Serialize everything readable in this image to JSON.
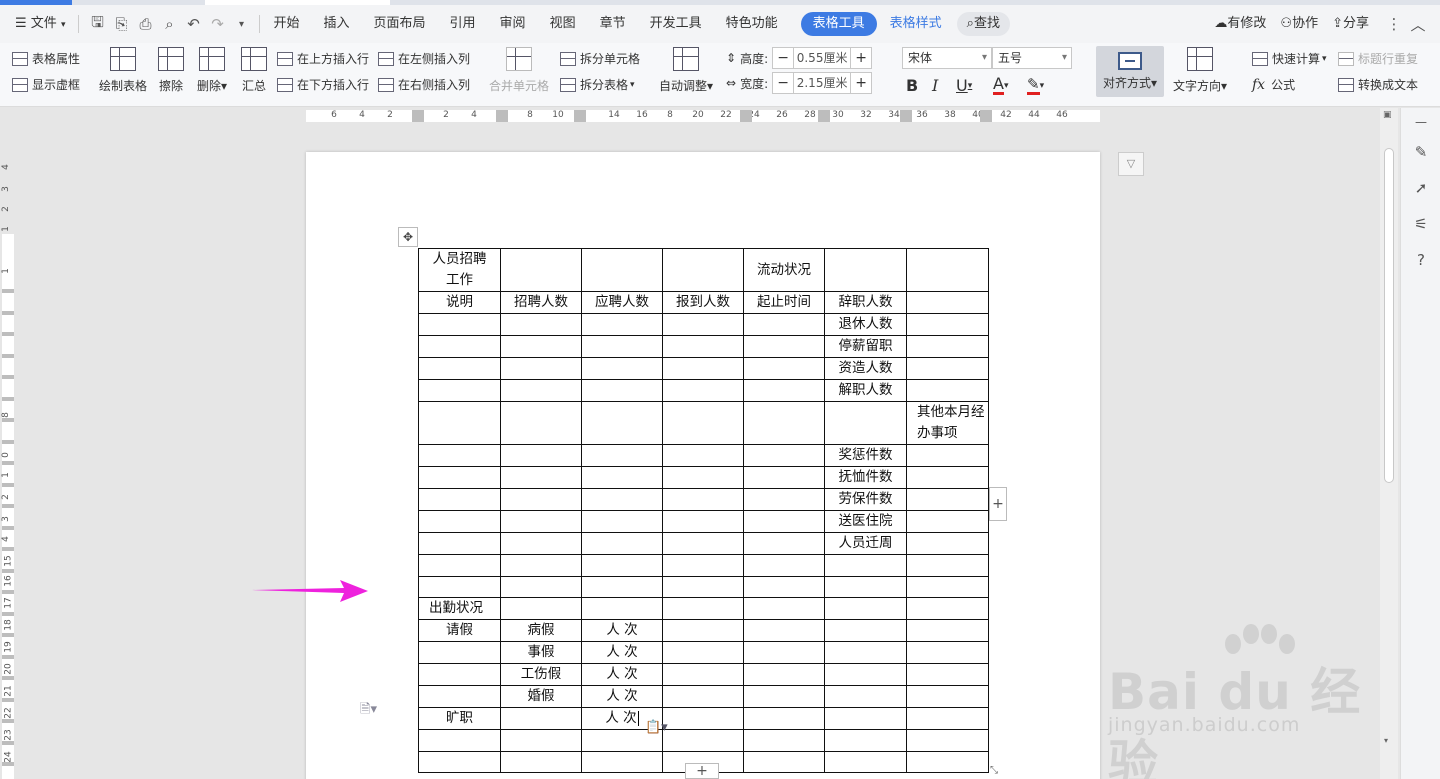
{
  "menubar": {
    "file": "文件",
    "tabs": [
      "开始",
      "插入",
      "页面布局",
      "引用",
      "审阅",
      "视图",
      "章节",
      "开发工具",
      "特色功能"
    ],
    "active_tab": "表格工具",
    "style_tab": "表格样式",
    "search": "查找",
    "right": {
      "changes": "有修改",
      "collab": "协作",
      "share": "分享"
    }
  },
  "ribbon": {
    "table_props": "表格属性",
    "show_grid": "显示虚框",
    "draw_table": "绘制表格",
    "erase": "擦除",
    "delete": "删除",
    "summary": "汇总",
    "insert_above": "在上方插入行",
    "insert_below": "在下方插入行",
    "insert_left": "在左侧插入列",
    "insert_right": "在右侧插入列",
    "merge": "合并单元格",
    "split_cell": "拆分单元格",
    "split_table": "拆分表格",
    "autofit": "自动调整",
    "height_label": "高度:",
    "height_value": "0.55厘米",
    "width_label": "宽度:",
    "width_value": "2.15厘米",
    "font_name": "宋体",
    "font_size": "五号",
    "align": "对齐方式",
    "text_dir": "文字方向",
    "quick_calc": "快速计算",
    "header_repeat": "标题行重复",
    "formula": "公式",
    "to_text": "转换成文本",
    "bold": "B",
    "italic": "I",
    "underline": "U",
    "font_color": "A"
  },
  "ruler": {
    "h_numbers": [
      "6",
      "4",
      "2",
      "2",
      "4",
      "8",
      "10",
      "14",
      "16",
      "8",
      "20",
      "22",
      "24",
      "26",
      "28",
      "30",
      "32",
      "34",
      "36",
      "38",
      "40",
      "42",
      "44",
      "46"
    ],
    "v_numbers": [
      "4",
      "3",
      "2",
      "1",
      "1",
      "8",
      "0",
      "1",
      "2",
      "3",
      "4",
      "15",
      "16",
      "17",
      "18",
      "19",
      "20",
      "21",
      "22",
      "23",
      "24"
    ]
  },
  "table": {
    "rows": [
      [
        "人员招聘工作",
        "",
        "",
        "",
        "流动状况",
        "",
        ""
      ],
      [
        "说明",
        "招聘人数",
        "应聘人数",
        "报到人数",
        "起止时间",
        "辞职人数",
        ""
      ],
      [
        "",
        "",
        "",
        "",
        "",
        "退休人数",
        ""
      ],
      [
        "",
        "",
        "",
        "",
        "",
        "停薪留职",
        ""
      ],
      [
        "",
        "",
        "",
        "",
        "",
        "资造人数",
        ""
      ],
      [
        "",
        "",
        "",
        "",
        "",
        "解职人数",
        ""
      ],
      [
        "",
        "",
        "",
        "",
        "",
        "",
        "其他本月经办事项"
      ],
      [
        "",
        "",
        "",
        "",
        "",
        "奖惩件数",
        ""
      ],
      [
        "",
        "",
        "",
        "",
        "",
        "抚恤件数",
        ""
      ],
      [
        "",
        "",
        "",
        "",
        "",
        "劳保件数",
        ""
      ],
      [
        "",
        "",
        "",
        "",
        "",
        "送医住院",
        ""
      ],
      [
        "",
        "",
        "",
        "",
        "",
        "人员迁周",
        ""
      ],
      [
        "",
        "",
        "",
        "",
        "",
        "",
        ""
      ],
      [
        "",
        "",
        "",
        "",
        "",
        "",
        ""
      ],
      [
        "出勤状况",
        "",
        "",
        "",
        "",
        "",
        ""
      ],
      [
        "请假",
        "病假",
        "人  次",
        "",
        "",
        "",
        ""
      ],
      [
        "",
        "事假",
        "人  次",
        "",
        "",
        "",
        ""
      ],
      [
        "",
        "工伤假",
        "人  次",
        "",
        "",
        "",
        ""
      ],
      [
        "",
        "婚假",
        "人  次",
        "",
        "",
        "",
        ""
      ],
      [
        "旷职",
        "",
        "人  次",
        "",
        "",
        "",
        ""
      ],
      [
        "",
        "",
        "",
        "",
        "",
        "",
        ""
      ],
      [
        "",
        "",
        "",
        "",
        "",
        "",
        ""
      ]
    ]
  },
  "watermark": {
    "big": "Bai du 经验",
    "small": "jingyan.baidu.com"
  },
  "colors": {
    "accent": "#3d7be3",
    "arrow": "#ee22dd"
  }
}
